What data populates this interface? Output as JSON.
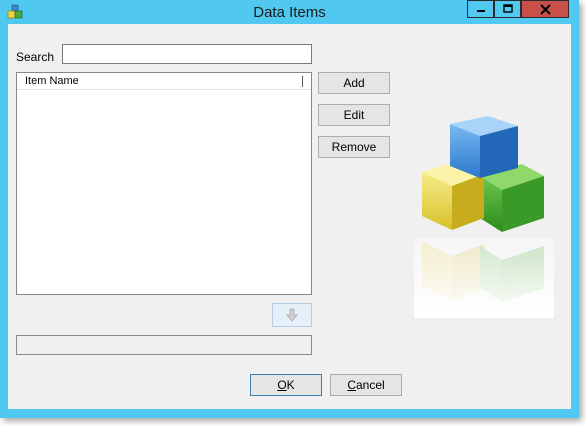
{
  "window": {
    "title": "Data Items"
  },
  "search": {
    "label": "Search",
    "value": ""
  },
  "list": {
    "column_header": "Item Name",
    "rows": []
  },
  "buttons": {
    "add": "Add",
    "edit": "Edit",
    "remove": "Remove"
  },
  "footer": {
    "ok_key": "O",
    "ok_rest": "K",
    "cancel_key": "C",
    "cancel_rest": "ancel",
    "status_value": ""
  },
  "icons": {
    "app": "cubes-icon",
    "move_down": "arrow-down-icon",
    "decoration": "colored-cubes-illustration"
  },
  "colors": {
    "titlebar": "#50c8f0",
    "close": "#c7504a",
    "dialog_bg": "#f0f0f0"
  }
}
